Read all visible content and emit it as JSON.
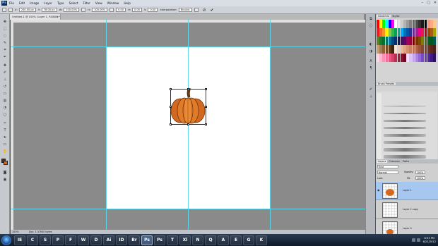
{
  "app": {
    "logo": "Ps"
  },
  "menu": {
    "items": [
      "File",
      "Edit",
      "Image",
      "Layer",
      "Type",
      "Select",
      "Filter",
      "View",
      "Window",
      "Help"
    ]
  },
  "window_controls": [
    "–",
    "□",
    "✕"
  ],
  "options_bar": {
    "x": "240.00 px",
    "y": "78.00 px",
    "w": "100.00%",
    "h": "100.00%",
    "angle": "0.00",
    "h_skew": "0.00",
    "v_skew": "0.00",
    "interpolation_label": "Interpolation:",
    "interpolation_value": "Bicubic",
    "cancel_glyph": "⊘",
    "commit_glyph": "✔"
  },
  "document": {
    "tab_title": "Untitled-1 @ 100% (Layer 1, RGB/8) *",
    "tab_close": "×"
  },
  "status_bar": {
    "zoom": "100%",
    "doc_info": "Doc: 1.37M/0 bytes"
  },
  "panels": {
    "top_tabs": [
      "Swatches",
      "Styles"
    ],
    "brush_tabs": [
      "Brush Presets"
    ],
    "layers_tabs": [
      "Layers",
      "Channels",
      "Paths"
    ],
    "blend_mode": "Normal",
    "kind_filter": "Kind",
    "opacity_label": "Opacity:",
    "opacity_value": "100%",
    "fill_label": "Fill:",
    "fill_value": "100%",
    "lock_label": "Lock:",
    "layers": [
      {
        "name": "Layer 1",
        "active": true
      },
      {
        "name": "Layer 1 copy",
        "active": false
      },
      {
        "name": "Layer 0",
        "active": false
      }
    ]
  },
  "swatch_colors": [
    "#ff0000",
    "#ffff00",
    "#00ff00",
    "#00ffff",
    "#0000ff",
    "#ff00ff",
    "#ffffff",
    "#e6e6e6",
    "#cccccc",
    "#b3b3b3",
    "#999999",
    "#808080",
    "#666666",
    "#4d4d4d",
    "#333333",
    "#1a1a1a",
    "#000000",
    "#f7977a",
    "#f9ad81",
    "#fdc68a",
    "#ed1c24",
    "#f26522",
    "#f7941d",
    "#fff200",
    "#8dc63f",
    "#39b54a",
    "#00a651",
    "#00a99d",
    "#00aeef",
    "#0072bc",
    "#0054a6",
    "#2e3192",
    "#662d91",
    "#92278f",
    "#ec008c",
    "#ed145b",
    "#9e0b0f",
    "#a0410d",
    "#a36209",
    "#aba000",
    "#598527",
    "#1a7b30",
    "#007236",
    "#00746b",
    "#0076a3",
    "#004b80",
    "#003471",
    "#1b1464",
    "#440e62",
    "#630460",
    "#9e005d",
    "#9e0039",
    "#790000",
    "#7b2e00",
    "#7d4900",
    "#827b00",
    "#406618",
    "#005e20",
    "#005826",
    "#005952",
    "#c69c6d",
    "#a67c52",
    "#8c6239",
    "#754c24",
    "#603913",
    "#3c2415",
    "#fbe4d2",
    "#f5cdb0",
    "#eab897",
    "#e0a482",
    "#d69070",
    "#c97f5f",
    "#bd6f51",
    "#ad6045",
    "#9c523a",
    "#8a4530",
    "#7a3a28",
    "#6b3021",
    "#5c281b",
    "#4d2116",
    "#ffd5e5",
    "#ffb3cc",
    "#ff8fb3",
    "#ff6b99",
    "#e85580",
    "#d44069",
    "#bf2d53",
    "#a31d40",
    "#8a1030",
    "#700724",
    "#f0e0ff",
    "#d9c2f5",
    "#c2a3eb",
    "#ab85e0",
    "#9466d6",
    "#7d47cc",
    "#6633b3",
    "#522599",
    "#3f1a80",
    "#2d1066"
  ],
  "taskbar": {
    "apps": [
      "IE",
      "C",
      "S",
      "P",
      "F",
      "W",
      "D",
      "Ai",
      "ID",
      "Br",
      "Ps",
      "Ps",
      "T",
      "Xl",
      "N",
      "Q",
      "A",
      "E",
      "G",
      "K"
    ],
    "active_index": 10,
    "time": "8:53 PM",
    "date": "6/21/2012"
  }
}
